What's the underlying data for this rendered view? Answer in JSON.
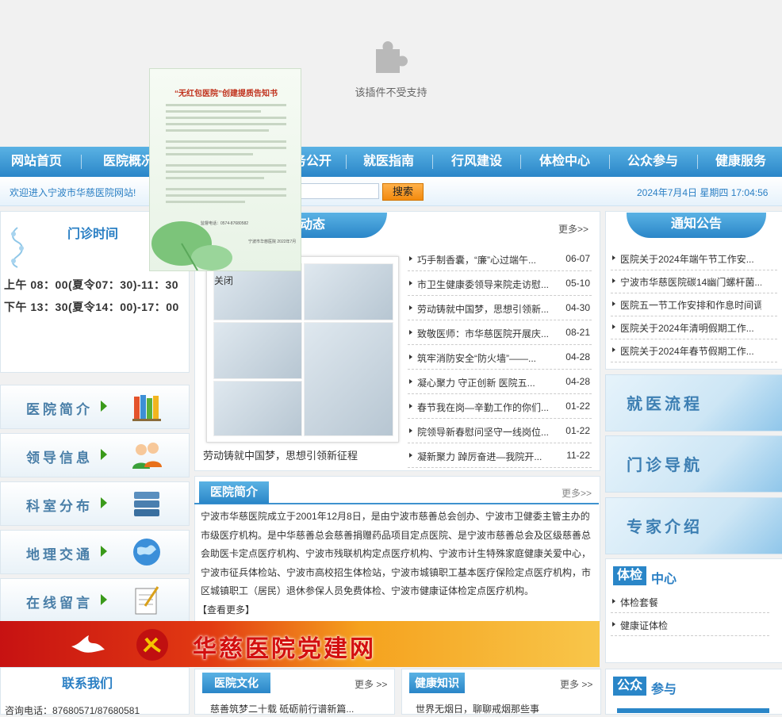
{
  "plugin": {
    "message": "该插件不受支持",
    "icon": "puzzle-icon"
  },
  "nav": {
    "items": [
      "网站首页",
      "医院概况",
      "院务公开",
      "就医指南",
      "行风建设",
      "体检中心",
      "公众参与",
      "健康服务"
    ]
  },
  "topbar": {
    "welcome": "欢迎进入宁波市华慈医院网站!",
    "search_label": "搜索",
    "datetime": "2024年7月4日 星期四 17:04:56"
  },
  "hours": {
    "title": "门诊时间",
    "morning": "上午 08：00(夏令07：30)-11：30",
    "afternoon": "下午 13：30(夏令14：00)-17：00"
  },
  "side_buttons": [
    {
      "label": "医院简介",
      "icon": "books-icon"
    },
    {
      "label": "领导信息",
      "icon": "people-icon"
    },
    {
      "label": "科室分布",
      "icon": "server-icon"
    },
    {
      "label": "地理交通",
      "icon": "globe-icon"
    },
    {
      "label": "在线留言",
      "icon": "notepad-icon"
    }
  ],
  "news": {
    "title_visible": "动态",
    "more": "更多>>",
    "caption": "劳动铸就中国梦，思想引领新征程",
    "items": [
      {
        "title": "巧手制香囊，“廉”心过端午...",
        "date": "06-07"
      },
      {
        "title": "市卫生健康委领导来院走访慰...",
        "date": "05-10"
      },
      {
        "title": "劳动铸就中国梦，思想引领新...",
        "date": "04-30"
      },
      {
        "title": "致敬医师：市华慈医院开展庆...",
        "date": "08-21"
      },
      {
        "title": "筑牢消防安全“防火墙”——...",
        "date": "04-28"
      },
      {
        "title": "凝心聚力 守正创新 医院五...",
        "date": "04-28"
      },
      {
        "title": "春节我在岗—辛勤工作的你们...",
        "date": "01-22"
      },
      {
        "title": "院领导新春慰问坚守一线岗位...",
        "date": "01-22"
      },
      {
        "title": "凝新聚力 踔厉奋进—我院开...",
        "date": "11-22"
      }
    ]
  },
  "intro": {
    "title": "医院简介",
    "more": "更多>>",
    "text": "宁波市华慈医院成立于2001年12月8日，是由宁波市慈善总会创办、宁波市卫健委主管主办的市级医疗机构。是中华慈善总会慈善捐赠药品项目定点医院、是宁波市慈善总会及区级慈善总会助医卡定点医疗机构、宁波市残联机构定点医疗机构、宁波市计生特殊家庭健康关爱中心，宁波市征兵体检站、宁波市高校招生体检站，宁波市城镇职工基本医疗保险定点医疗机构，市区城镇职工（居民）退休参保人员免费体检、宁波市健康证体检定点医疗机构。",
    "read_more": "【查看更多】"
  },
  "banner": {
    "text": "华慈医院党建网"
  },
  "contact": {
    "title": "联系我们",
    "phone": "咨询电话：87680571/87680581"
  },
  "culture": {
    "title": "医院文化",
    "more": "更多 >>",
    "item": "慈善筑梦二十载 砥砺前行谱新篇..."
  },
  "health": {
    "title": "健康知识",
    "more": "更多 >>",
    "item": "世界无烟日，聊聊戒烟那些事"
  },
  "notice": {
    "title": "通知公告",
    "items": [
      "医院关于2024年端午节工作安...",
      "宁波市华慈医院碳14幽门螺杆菌...",
      "医院五一节工作安排和作息时间调...",
      "医院关于2024年清明假期工作...",
      "医院关于2024年春节假期工作..."
    ]
  },
  "right_buttons": [
    "就医流程",
    "门诊导航",
    "专家介绍"
  ],
  "exam": {
    "h1": "体检",
    "h2": "中心",
    "items": [
      "体检套餐",
      "健康证体检"
    ]
  },
  "public": {
    "h1": "公众",
    "h2": "参与"
  },
  "popup": {
    "title": "“无红包医院”创建提质告知书",
    "phone": "监督电话：0574-87680582",
    "org": "宁波市华慈医院 2022年7月",
    "close": "关闭"
  },
  "colors": {
    "primary": "#2a86c8",
    "accent": "#f28a0e",
    "banner_red": "#d30f0f"
  }
}
